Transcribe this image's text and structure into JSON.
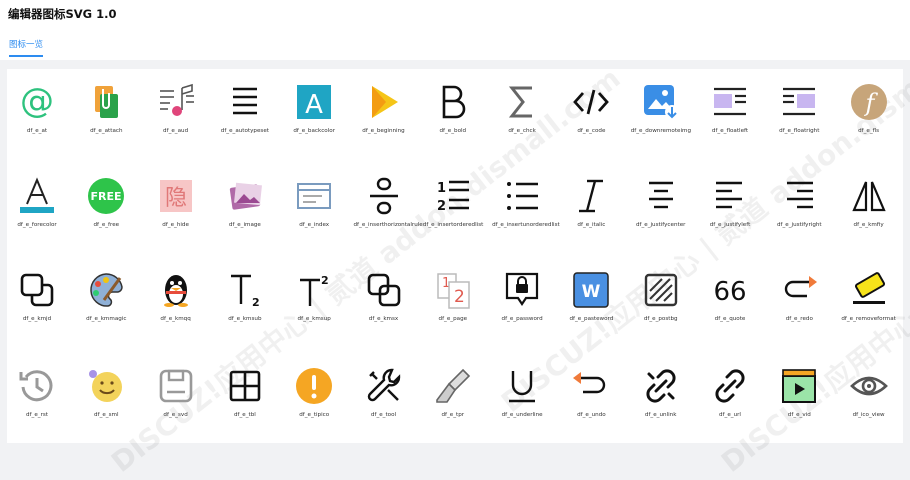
{
  "header": {
    "title": "编辑器图标SVG 1.0",
    "tab": "图标一览"
  },
  "watermark": "DISCUZ!应用中心 | 贰道 addon.dismall.com",
  "icons": [
    {
      "label": "df_e_at",
      "icon": "at-icon"
    },
    {
      "label": "df_e_attach",
      "icon": "attach-icon"
    },
    {
      "label": "df_e_aud",
      "icon": "audio-icon"
    },
    {
      "label": "df_e_autotypeset",
      "icon": "autotypeset-icon"
    },
    {
      "label": "df_e_backcolor",
      "icon": "backcolor-icon"
    },
    {
      "label": "df_e_beginning",
      "icon": "beginning-icon"
    },
    {
      "label": "df_e_bold",
      "icon": "bold-icon"
    },
    {
      "label": "df_e_chck",
      "icon": "sigma-icon"
    },
    {
      "label": "df_e_code",
      "icon": "code-icon"
    },
    {
      "label": "df_e_downremoteimg",
      "icon": "download-image-icon"
    },
    {
      "label": "df_e_floatleft",
      "icon": "float-left-icon"
    },
    {
      "label": "df_e_floatright",
      "icon": "float-right-icon"
    },
    {
      "label": "df_e_fls",
      "icon": "flash-icon"
    },
    {
      "label": "df_e_forecolor",
      "icon": "forecolor-icon"
    },
    {
      "label": "df_e_free",
      "icon": "free-icon"
    },
    {
      "label": "df_e_hide",
      "icon": "hide-icon"
    },
    {
      "label": "df_e_image",
      "icon": "image-icon"
    },
    {
      "label": "df_e_index",
      "icon": "index-icon"
    },
    {
      "label": "df_e_inserthorizontalrule",
      "icon": "horizontal-rule-icon"
    },
    {
      "label": "df_e_insertorderedlist",
      "icon": "ordered-list-icon"
    },
    {
      "label": "df_e_insertunorderedlist",
      "icon": "unordered-list-icon"
    },
    {
      "label": "df_e_italic",
      "icon": "italic-icon"
    },
    {
      "label": "df_e_justifycenter",
      "icon": "justify-center-icon"
    },
    {
      "label": "df_e_justifyleft",
      "icon": "justify-left-icon"
    },
    {
      "label": "df_e_justifyright",
      "icon": "justify-right-icon"
    },
    {
      "label": "df_e_kmfiy",
      "icon": "mirror-icon"
    },
    {
      "label": "df_e_kmjd",
      "icon": "layers-icon"
    },
    {
      "label": "df_e_kmmagic",
      "icon": "palette-icon"
    },
    {
      "label": "df_e_kmqq",
      "icon": "qq-penguin-icon"
    },
    {
      "label": "df_e_kmsub",
      "icon": "subscript-icon"
    },
    {
      "label": "df_e_kmsup",
      "icon": "superscript-icon"
    },
    {
      "label": "df_e_kmsx",
      "icon": "overlap-icon"
    },
    {
      "label": "df_e_page",
      "icon": "page-icon"
    },
    {
      "label": "df_e_password",
      "icon": "password-icon"
    },
    {
      "label": "df_e_pasteword",
      "icon": "word-icon"
    },
    {
      "label": "df_e_postbg",
      "icon": "postbg-icon"
    },
    {
      "label": "df_e_quote",
      "icon": "quote-icon"
    },
    {
      "label": "df_e_redo",
      "icon": "redo-icon"
    },
    {
      "label": "df_e_removeformat",
      "icon": "eraser-icon"
    },
    {
      "label": "df_e_rst",
      "icon": "history-icon"
    },
    {
      "label": "df_e_sml",
      "icon": "smile-icon"
    },
    {
      "label": "df_e_svd",
      "icon": "save-icon"
    },
    {
      "label": "df_e_tbl",
      "icon": "table-icon"
    },
    {
      "label": "df_e_tipico",
      "icon": "tip-icon"
    },
    {
      "label": "df_e_tool",
      "icon": "tool-icon"
    },
    {
      "label": "df_e_tpr",
      "icon": "brush-icon"
    },
    {
      "label": "df_e_underline",
      "icon": "underline-icon"
    },
    {
      "label": "df_e_undo",
      "icon": "undo-icon"
    },
    {
      "label": "df_e_unlink",
      "icon": "unlink-icon"
    },
    {
      "label": "df_e_url",
      "icon": "link-icon"
    },
    {
      "label": "df_e_vid",
      "icon": "video-icon"
    },
    {
      "label": "df_ico_view",
      "icon": "eye-icon"
    }
  ]
}
